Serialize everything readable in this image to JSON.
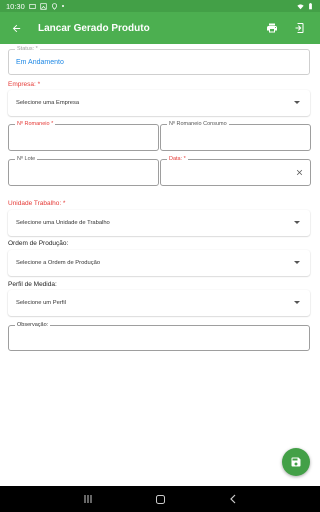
{
  "statusbar": {
    "time": "10:30"
  },
  "appbar": {
    "title": "Lancar Gerado Produto"
  },
  "form": {
    "status": {
      "label": "Status: *",
      "value": "Em Andamento"
    },
    "empresa": {
      "label": "Empresa: *",
      "placeholder": "Selecione uma Empresa"
    },
    "romaneio": {
      "label": "Nº Romaneio *"
    },
    "romaneio_consumo": {
      "label": "Nº Romaneio Consumo"
    },
    "lote": {
      "label": "Nº Lote"
    },
    "data": {
      "label": "Data: *"
    },
    "unidade": {
      "label": "Unidade Trabalho: *",
      "placeholder": "Selecione uma Unidade de Trabalho"
    },
    "ordem": {
      "label": "Ordem de Produção:",
      "placeholder": "Selecione a Ordem de Produção"
    },
    "perfil": {
      "label": "Perfil de Medida:",
      "placeholder": "Selecione um Perfil"
    },
    "observacao": {
      "label": "Observação:"
    }
  },
  "colors": {
    "primary": "#4caf50",
    "statusbar": "#43a047",
    "required": "#e53935",
    "value": "#1e88e5"
  },
  "icons": [
    "back-arrow-icon",
    "print-icon",
    "export-icon",
    "close-icon",
    "save-icon",
    "dropdown-caret-icon"
  ]
}
